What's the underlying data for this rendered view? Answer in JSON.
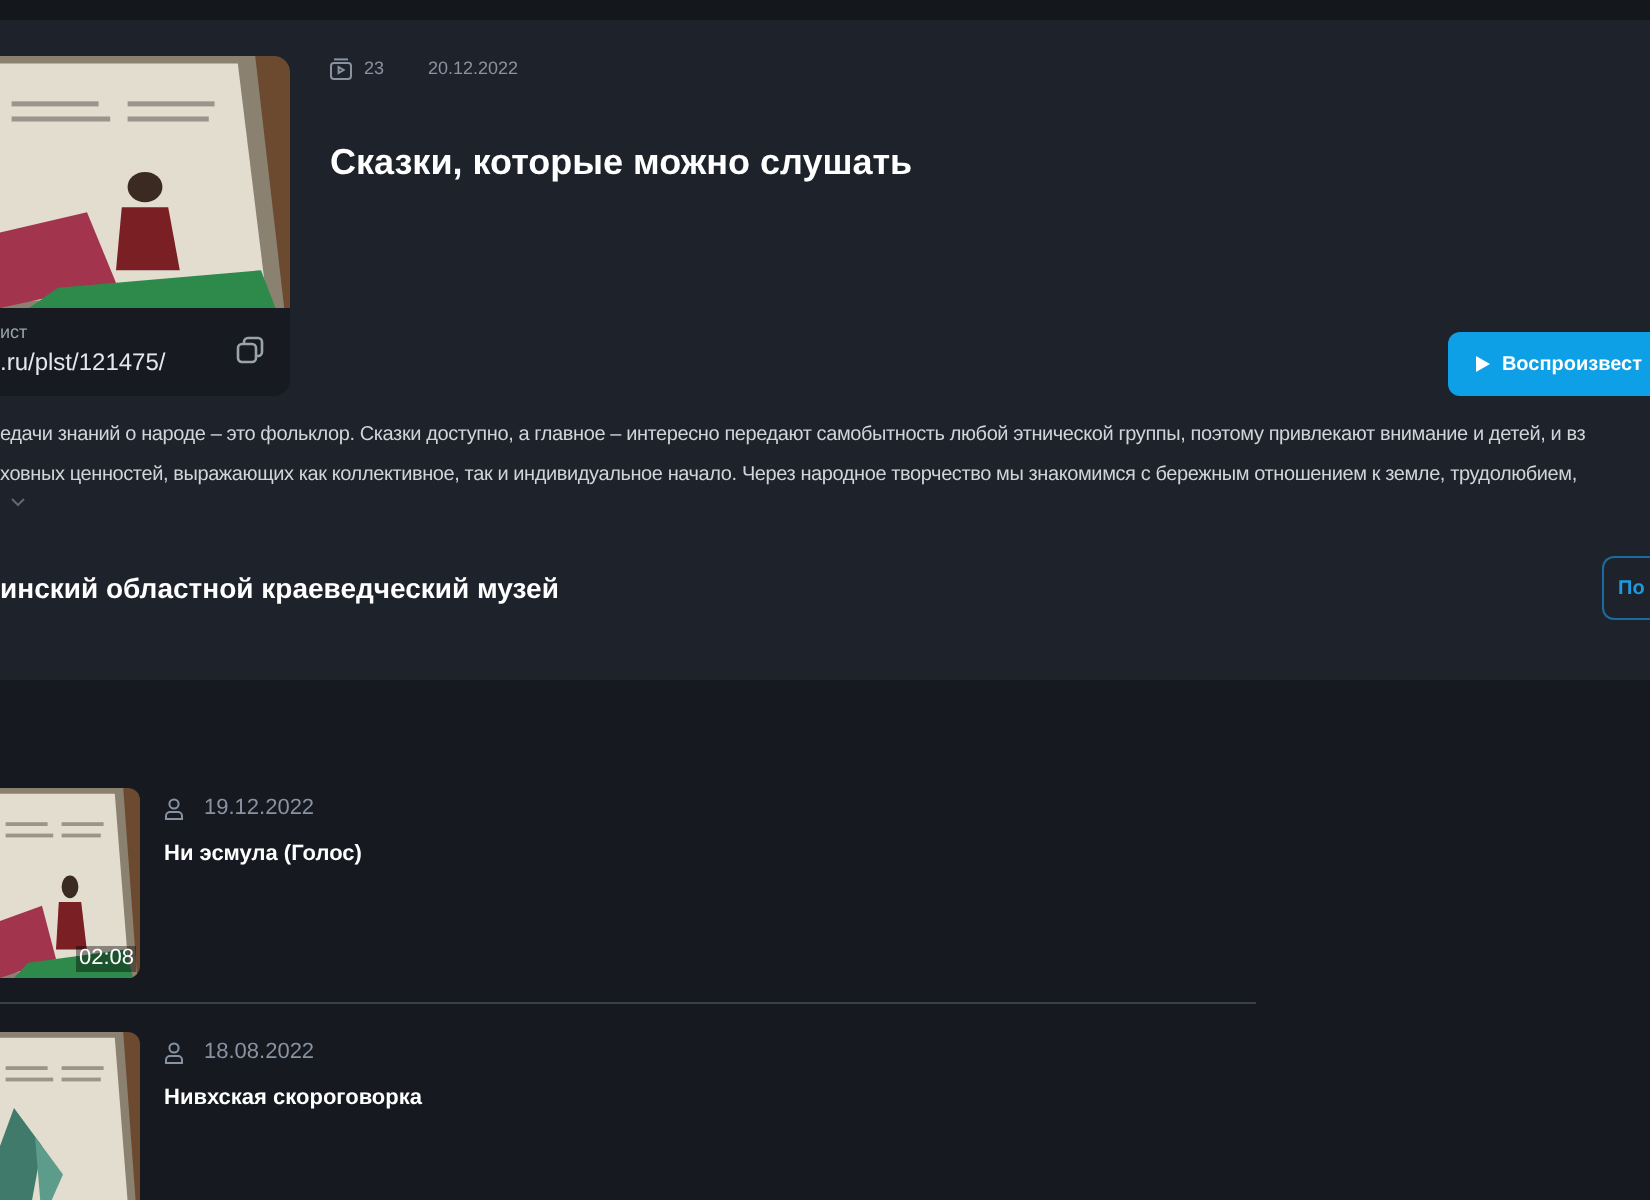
{
  "playlist": {
    "cover": {
      "kind": "picture",
      "caption_label": "ист",
      "link": ".ru/plst/121475/"
    },
    "count": "23",
    "date": "20.12.2022",
    "title": "Сказки, которые можно слушать",
    "play_button": "Воспроизвест",
    "description_lines": [
      "едачи знаний о народе – это фольклор. Сказки доступно, а главное – интересно передают самобытность любой этнической группы, поэтому привлекают внимание и детей, и вз",
      "ховных ценностей, выражающих как коллективное, так и индивидуальное начало. Через народное творчество мы знакомимся с бережным отношением к земле, трудолюбием,"
    ],
    "expanded": false,
    "author": "инский областной краеведческий музей",
    "author_button": "По"
  },
  "tracks": [
    {
      "date": "19.12.2022",
      "title": "Ни эсмула (Голос)",
      "duration": "02:08"
    },
    {
      "date": "18.08.2022",
      "title": "Нивхская скороговорка"
    }
  ]
}
